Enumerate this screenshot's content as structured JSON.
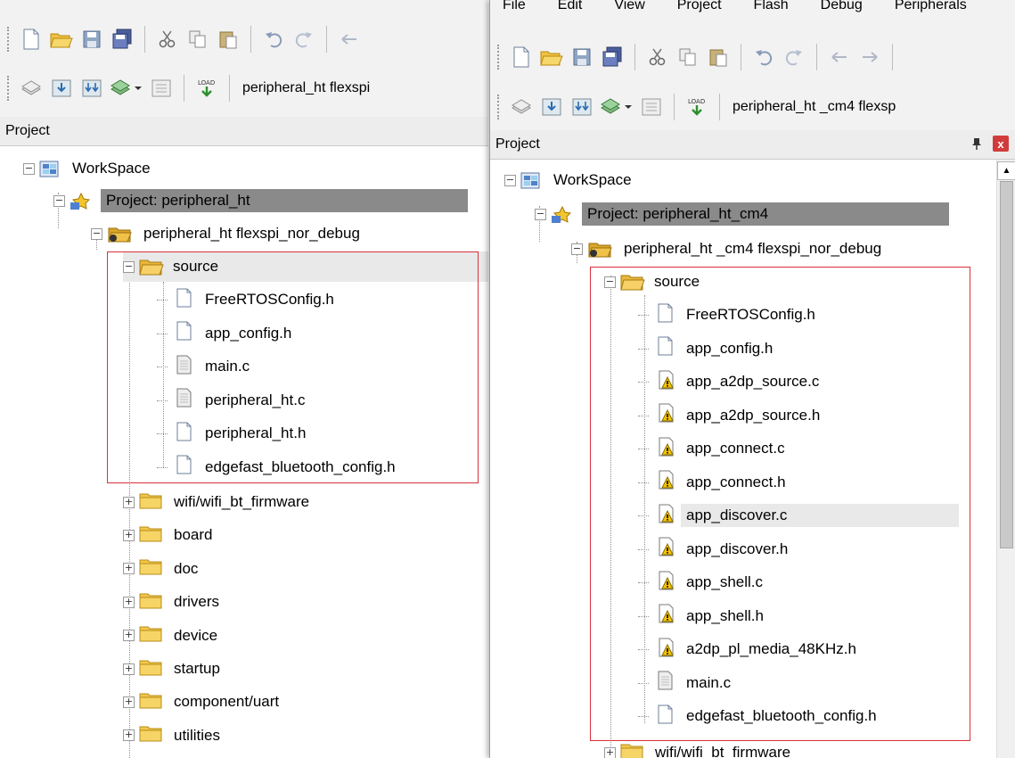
{
  "left": {
    "toolbar_target": "peripheral_ht flexspi",
    "project_title": "Project",
    "tree": {
      "workspace": "WorkSpace",
      "project": "Project: peripheral_ht",
      "target": "peripheral_ht flexspi_nor_debug",
      "source": "source",
      "source_files": [
        {
          "name": "FreeRTOSConfig.h",
          "icon": "header-file-icon"
        },
        {
          "name": "app_config.h",
          "icon": "header-file-icon"
        },
        {
          "name": "main.c",
          "icon": "c-file-icon"
        },
        {
          "name": "peripheral_ht.c",
          "icon": "c-file-icon"
        },
        {
          "name": "peripheral_ht.h",
          "icon": "header-file-icon"
        },
        {
          "name": "edgefast_bluetooth_config.h",
          "icon": "header-file-icon"
        }
      ],
      "groups": [
        "wifi/wifi_bt_firmware",
        "board",
        "doc",
        "drivers",
        "device",
        "startup",
        "component/uart",
        "utilities"
      ]
    }
  },
  "right": {
    "menu": [
      "File",
      "Edit",
      "View",
      "Project",
      "Flash",
      "Debug",
      "Peripherals"
    ],
    "toolbar_target": "peripheral_ht _cm4 flexsp",
    "project_title": "Project",
    "pin_icon": "pin-icon",
    "close_label": "x",
    "tree": {
      "workspace": "WorkSpace",
      "project": "Project: peripheral_ht_cm4",
      "target": "peripheral_ht _cm4 flexspi_nor_debug",
      "source": "source",
      "source_files": [
        {
          "name": "FreeRTOSConfig.h",
          "icon": "header-file-icon"
        },
        {
          "name": "app_config.h",
          "icon": "header-file-icon"
        },
        {
          "name": "app_a2dp_source.c",
          "icon": "warning-file-icon"
        },
        {
          "name": "app_a2dp_source.h",
          "icon": "warning-file-icon"
        },
        {
          "name": "app_connect.c",
          "icon": "warning-file-icon"
        },
        {
          "name": "app_connect.h",
          "icon": "warning-file-icon"
        },
        {
          "name": "app_discover.c",
          "icon": "warning-file-icon"
        },
        {
          "name": "app_discover.h",
          "icon": "warning-file-icon"
        },
        {
          "name": "app_shell.c",
          "icon": "warning-file-icon"
        },
        {
          "name": "app_shell.h",
          "icon": "warning-file-icon"
        },
        {
          "name": "a2dp_pl_media_48KHz.h",
          "icon": "warning-file-icon"
        },
        {
          "name": "main.c",
          "icon": "c-file-icon"
        },
        {
          "name": "edgefast_bluetooth_config.h",
          "icon": "header-file-icon"
        }
      ],
      "groups": [
        "wifi/wifi_bt_firmware"
      ]
    }
  },
  "colors": {
    "selection": "#8a8a8a",
    "highlight_box": "#d9303a",
    "folder": "#f3c64b",
    "warning": "#f5c400"
  }
}
